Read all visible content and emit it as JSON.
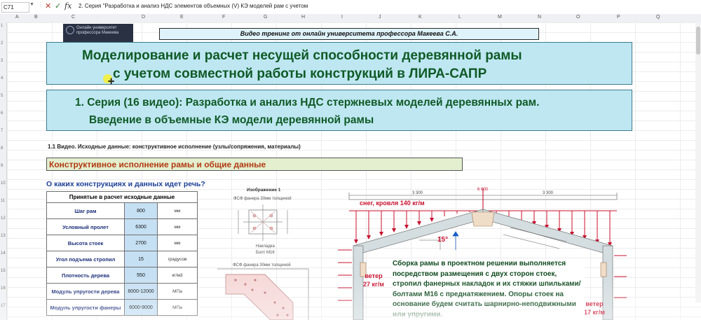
{
  "formula_bar": {
    "name_box": "C71",
    "formula": "2. Серия \"Разработка и анализ НДС элементов объемных (V) КЭ моделей рам с учетом"
  },
  "columns": [
    "A",
    "B",
    "C",
    "D",
    "E",
    "F",
    "G",
    "H",
    "I",
    "J",
    "K",
    "L",
    "M",
    "N",
    "O",
    "P",
    "Q"
  ],
  "rows": [
    "1",
    "2",
    "3",
    "4",
    "5",
    "6",
    "7",
    "8",
    "9",
    "10",
    "11",
    "12",
    "13",
    "14",
    "15",
    "16",
    "17"
  ],
  "logo_text": "Онлайн университет профессора Макеева",
  "promo": "Видео тренинг от онлайн университета профессора Макеева С.А.",
  "title": {
    "line1": "Моделирование и расчет несущей способности деревянной рамы",
    "line2": "с учетом совместной работы конструкций в ЛИРА-САПР"
  },
  "series": {
    "line1": "1. Серия (16 видео): Разработка и анализ НДС стержневых моделей деревянных рам.",
    "line2": "Введение в объемные КЭ модели деревянной рамы"
  },
  "subhead": "1.1 Видео. Исходные данные: конструктивное исполнение (узлы/сопряжения, материалы)",
  "section_title": "Конструктивное исполнение рамы и общие данные",
  "question": "О каких конструкциях и данных идет речь?",
  "table": {
    "header": "Принятые в расчет исходные данные",
    "rows": [
      {
        "name": "Шаг рам",
        "value": "800",
        "unit": "мм"
      },
      {
        "name": "Условный пролет",
        "value": "6300",
        "unit": "мм"
      },
      {
        "name": "Высота стоек",
        "value": "2700",
        "unit": "мм"
      },
      {
        "name": "Угол подъема стропил",
        "value": "15",
        "unit": "градусов"
      },
      {
        "name": "Плотность дерева",
        "value": "550",
        "unit": "кг/м3"
      },
      {
        "name": "Модуль упругости дерева",
        "value": "8000-12000",
        "unit": "МПа"
      },
      {
        "name": "Модуль упругости фанеры",
        "value": "6000-9000",
        "unit": "МПа"
      }
    ]
  },
  "drawing": {
    "image_title": "Изображение 1",
    "plywood_1": "ФСФ фанера 30мм толщиной",
    "overlay": "Накладка",
    "bolt": "Болт М16",
    "plywood_2": "ФСФ фанера 30мм толщиной"
  },
  "frame": {
    "snow_label": "снег, кровля 140 кг/м",
    "angle_label": "15°",
    "wind_left": [
      "ветер",
      "27 кг/м"
    ],
    "wind_right": [
      "ветер",
      "17 кг/м"
    ],
    "dim_top_left": "3 300",
    "dim_top_right": "3 300",
    "dim_ridge": "6 600"
  },
  "note": "Сборка рамы в проектном решении выполняется посредством размещения с двух сторон стоек, стропил фанерных накладок и их стяжки шпильками/болтами М16 с преднатяжением. Опоры стоек на основание будем считать шарнирно-неподвижными или упругими.",
  "colors": {
    "title_bg": "#bfe7f2",
    "title_text": "#0f5a26",
    "section_bg": "#e3efcf",
    "section_text": "#b23a12",
    "question_text": "#1c3f96",
    "load_red": "#c8102e",
    "value_cell": "#c6e0f3"
  }
}
